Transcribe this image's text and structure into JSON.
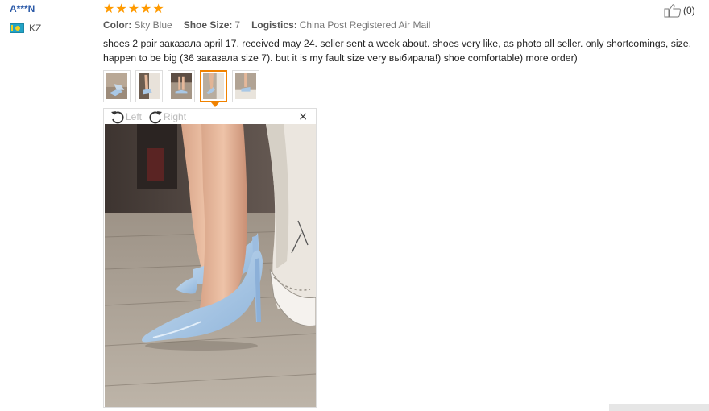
{
  "reviewer": {
    "name": "A***N",
    "country": "KZ"
  },
  "rating": {
    "stars": 5,
    "max": 5
  },
  "helpful": {
    "count": "(0)"
  },
  "attributes": [
    {
      "label": "Color:",
      "value": "Sky Blue"
    },
    {
      "label": "Shoe Size:",
      "value": "7"
    },
    {
      "label": "Logistics:",
      "value": "China Post Registered Air Mail"
    }
  ],
  "review": {
    "text": "shoes 2 pair заказала april 17, received may 24. seller sent a week about. shoes very like, as photo all seller. only shortcomings, size, happen to be big (36 заказала size 7). but it is my fault size very выбирала!) shoe comfortable) more order)"
  },
  "thumbnails": {
    "count": 5,
    "active_index": 3
  },
  "viewer": {
    "rotate_left": "Left",
    "rotate_right": "Right",
    "close": "×"
  },
  "colors": {
    "accent": "#f08200",
    "star": "#ff9a00",
    "name": "#2b5aa8",
    "shoe": "#a9c8e6"
  }
}
